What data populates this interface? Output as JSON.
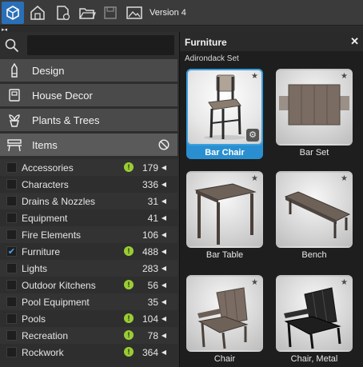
{
  "toolbar": {
    "version": "Version 4"
  },
  "search": {
    "placeholder": "",
    "value": ""
  },
  "categories": [
    {
      "label": "Design",
      "icon": "pencil-icon"
    },
    {
      "label": "House Decor",
      "icon": "frame-icon"
    },
    {
      "label": "Plants & Trees",
      "icon": "plant-icon"
    },
    {
      "label": "Items",
      "icon": "bench-icon"
    }
  ],
  "items_list": [
    {
      "label": "Accessories",
      "count": "179",
      "alert": true,
      "checked": false
    },
    {
      "label": "Characters",
      "count": "336",
      "alert": false,
      "checked": false
    },
    {
      "label": "Drains & Nozzles",
      "count": "31",
      "alert": false,
      "checked": false
    },
    {
      "label": "Equipment",
      "count": "41",
      "alert": false,
      "checked": false
    },
    {
      "label": "Fire Elements",
      "count": "106",
      "alert": false,
      "checked": false
    },
    {
      "label": "Furniture",
      "count": "488",
      "alert": true,
      "checked": true
    },
    {
      "label": "Lights",
      "count": "283",
      "alert": false,
      "checked": false
    },
    {
      "label": "Outdoor Kitchens",
      "count": "56",
      "alert": true,
      "checked": false
    },
    {
      "label": "Pool Equipment",
      "count": "35",
      "alert": false,
      "checked": false
    },
    {
      "label": "Pools",
      "count": "104",
      "alert": true,
      "checked": false
    },
    {
      "label": "Recreation",
      "count": "78",
      "alert": true,
      "checked": false
    },
    {
      "label": "Rockwork",
      "count": "364",
      "alert": true,
      "checked": false
    }
  ],
  "panel": {
    "title": "Furniture",
    "subtitle": "Adirondack Set",
    "tiles": [
      {
        "label": "Bar Chair",
        "selected": true
      },
      {
        "label": "Bar Set",
        "selected": false
      },
      {
        "label": "Bar Table",
        "selected": false
      },
      {
        "label": "Bench",
        "selected": false
      },
      {
        "label": "Chair",
        "selected": false
      },
      {
        "label": "Chair, Metal",
        "selected": false
      }
    ]
  },
  "colors": {
    "accent": "#2a8fd0",
    "alert": "#9acd32",
    "logo": "#2a6fb8"
  }
}
